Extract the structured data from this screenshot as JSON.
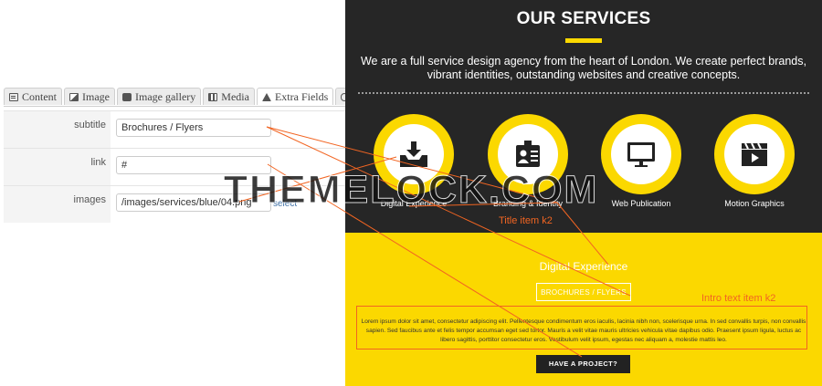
{
  "admin": {
    "tabs": [
      {
        "label": "Content",
        "icon": "document-icon"
      },
      {
        "label": "Image",
        "icon": "image-icon"
      },
      {
        "label": "Image gallery",
        "icon": "camera-icon"
      },
      {
        "label": "Media",
        "icon": "film-icon"
      },
      {
        "label": "Extra Fields",
        "icon": "flask-icon"
      },
      {
        "label": "",
        "icon": "paperclip-icon"
      }
    ],
    "fields": [
      {
        "label": "subtitle",
        "value": "Brochures / Flyers"
      },
      {
        "label": "link",
        "value": "#"
      },
      {
        "label": "images",
        "value": "/images/services/blue/04.png",
        "action": "select"
      }
    ]
  },
  "promo": {
    "title": "OUR SERVICES",
    "intro": "We are a full service design agency from the heart of London. We create perfect brands, vibrant identities, outstanding websites and creative concepts.",
    "services": [
      {
        "label": "Digital Experience",
        "icon": "inbox-download-icon"
      },
      {
        "label": "Branding & Identity",
        "icon": "id-badge-icon"
      },
      {
        "label": "Web Publication",
        "icon": "monitor-icon"
      },
      {
        "label": "Motion Graphics",
        "icon": "clapperboard-icon"
      }
    ],
    "detail_title": "Digital Experience",
    "detail_button": "BROCHURES / FLYERS",
    "lorem": "Lorem ipsum dolor sit amet, consectetur adipiscing elit. Pellentesque condimentum eros iaculis, lacinia nibh non, scelerisque urna. In sed convallis turpis, non convallis sapien. Sed faucibus ante et felis tempor accumsan eget sed tortor. Mauris a velit vitae mauris ultricies vehicula vitae dapibus odio. Praesent ipsum ligula, luctus ac libero sagittis, porttitor consectetur eros. Vestibulum velit ipsum, egestas nec aliquam a, molestie mattis leo.",
    "cta": "HAVE A PROJECT?"
  },
  "annotations": {
    "title_item": "Title item k2",
    "intro_item": "Intro text item k2"
  },
  "watermark": "THEMELOCK.COM",
  "colors": {
    "accent": "#fbd800",
    "dark": "#262626",
    "annotation": "#f26522"
  }
}
